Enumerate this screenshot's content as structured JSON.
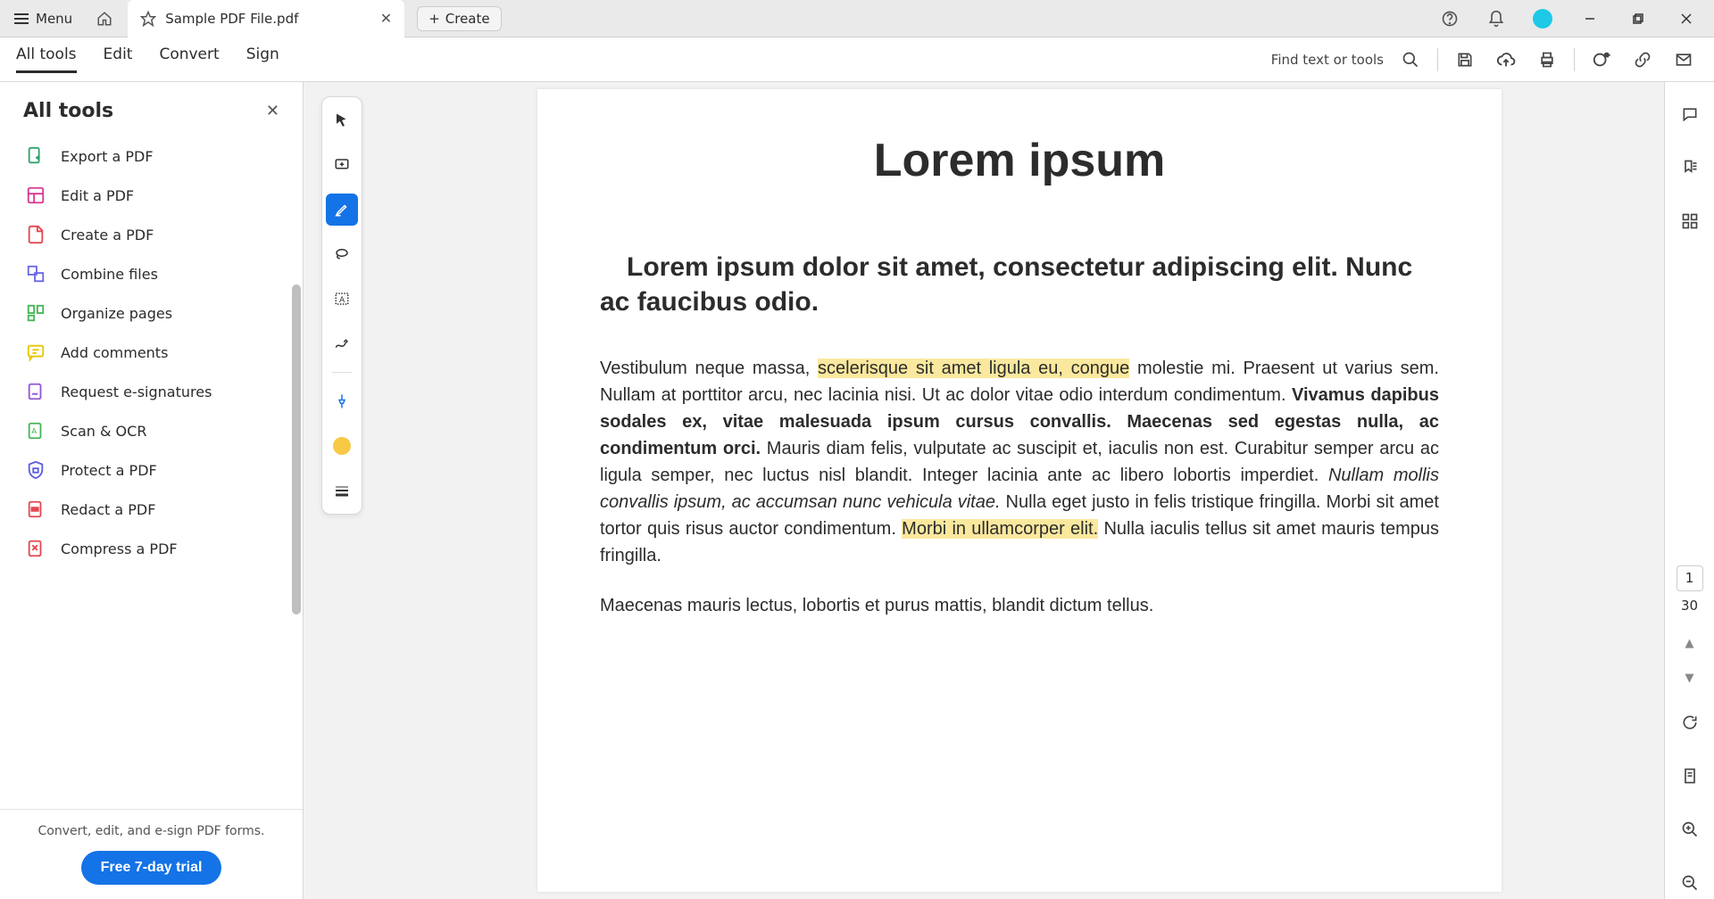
{
  "titlebar": {
    "menu": "Menu",
    "tab_title": "Sample PDF File.pdf",
    "create": "Create"
  },
  "toolbar": {
    "nav": [
      "All tools",
      "Edit",
      "Convert",
      "Sign"
    ],
    "active_index": 0,
    "find": "Find text or tools"
  },
  "sidebar": {
    "title": "All tools",
    "items": [
      "Export a PDF",
      "Edit a PDF",
      "Create a PDF",
      "Combine files",
      "Organize pages",
      "Add comments",
      "Request e-signatures",
      "Scan & OCR",
      "Protect a PDF",
      "Redact a PDF",
      "Compress a PDF"
    ],
    "footer_text": "Convert, edit, and e-sign PDF forms.",
    "trial": "Free 7-day trial"
  },
  "document": {
    "title": "Lorem ipsum",
    "subtitle": "Lorem ipsum dolor sit amet, consectetur adipiscing elit. Nunc ac faucibus odio.",
    "p1_a": "Vestibulum neque massa, ",
    "p1_hl1": "scelerisque sit amet ligula eu, congue",
    "p1_b": " molestie mi. Praesent ut varius sem. Nullam at porttitor arcu, nec lacinia nisi. Ut ac dolor vitae odio interdum condimentum. ",
    "p1_bold": "Vivamus dapibus sodales ex, vitae malesuada ipsum cursus convallis. Maecenas sed egestas nulla, ac condimentum orci.",
    "p1_c": " Mauris diam felis, vulputate ac suscipit et, iaculis non est. Curabitur semper arcu ac ligula semper, nec luctus nisl blandit. Integer lacinia ante ac libero lobortis imperdiet. ",
    "p1_italic": "Nullam mollis convallis ipsum, ac accumsan nunc vehicula vitae.",
    "p1_d": " Nulla eget justo in felis tristique fringilla. Morbi sit amet tortor quis risus auctor condimentum. ",
    "p1_hl2": "Morbi in ullamcorper elit.",
    "p1_e": " Nulla iaculis tellus sit amet mauris tempus fringilla.",
    "p2": "Maecenas mauris lectus, lobortis et purus mattis, blandit dictum tellus."
  },
  "page_nav": {
    "current": "1",
    "total": "30"
  },
  "icons": {
    "export": "#2fa36e",
    "edit": "#d83790",
    "create": "#e34850",
    "combine": "#6868e6",
    "organize": "#44b556",
    "comments": "#e8c600",
    "esign": "#9256d9",
    "scan": "#44b556",
    "protect": "#5c5ce0",
    "redact": "#e34850",
    "compress": "#e34850"
  }
}
